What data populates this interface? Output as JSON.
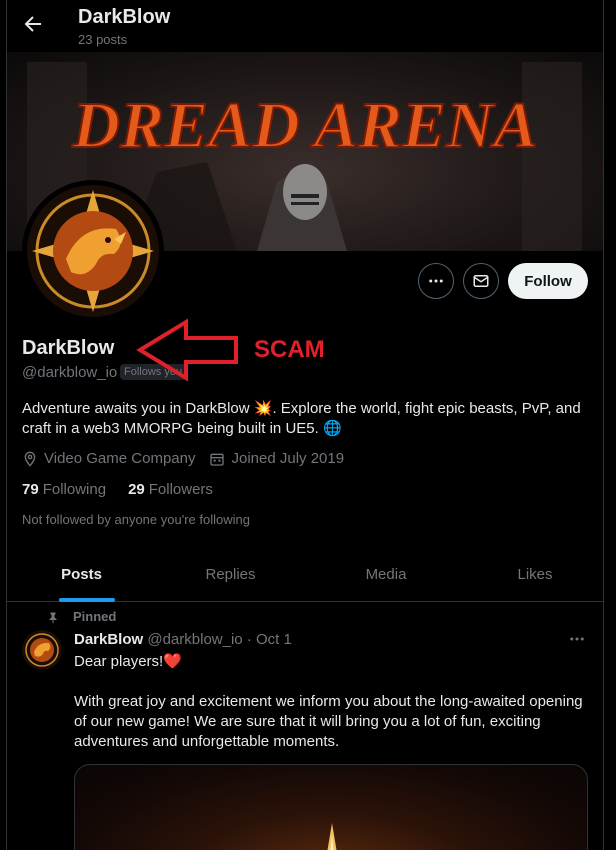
{
  "header": {
    "title": "DarkBlow",
    "post_count": "23 posts"
  },
  "banner": {
    "title_text": "DREAD ARENA"
  },
  "profile": {
    "name": "DarkBlow",
    "handle": "@darkblow_io",
    "follows_you": "Follows you",
    "bio": "Adventure awaits you in DarkBlow 💥. Explore the world, fight epic beasts, PvP, and craft in a web3 MMORPG being built in UE5. 🌐",
    "category": "Video Game Company",
    "joined": "Joined July 2019",
    "following_count": "79",
    "following_label": "Following",
    "followers_count": "29",
    "followers_label": "Followers",
    "not_followed": "Not followed by anyone you're following"
  },
  "actions": {
    "follow_label": "Follow"
  },
  "annotation": {
    "label": "SCAM",
    "color": "#e0202a"
  },
  "tabs": [
    {
      "label": "Posts"
    },
    {
      "label": "Replies"
    },
    {
      "label": "Media"
    },
    {
      "label": "Likes"
    }
  ],
  "post": {
    "pinned_label": "Pinned",
    "author": "DarkBlow",
    "handle_date": "@darkblow_io · Oct 1",
    "line1": "Dear players!❤️",
    "line2": "With great joy and excitement we inform you about the long-awaited opening of our new game! We are sure that it will bring you a lot of fun, exciting adventures and unforgettable moments."
  },
  "colors": {
    "accent": "#1d9bf0",
    "background": "#000000",
    "text": "#e7e9ea",
    "muted": "#71767b"
  }
}
